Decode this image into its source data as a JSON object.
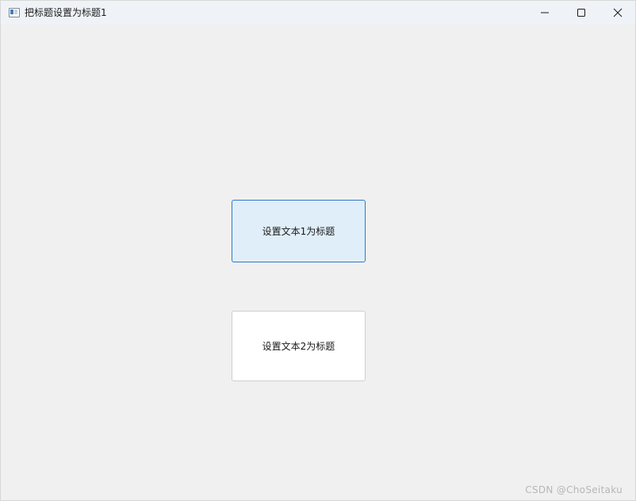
{
  "window": {
    "title": "把标题设置为标题1",
    "controls": {
      "minimize_icon": "minimize-icon",
      "maximize_icon": "maximize-icon",
      "close_icon": "close-icon"
    }
  },
  "buttons": {
    "text1_label": "设置文本1为标题",
    "text2_label": "设置文本2为标题"
  },
  "watermark": "CSDN @ChoSeitaku",
  "colors": {
    "titlebar": "#eff3f7",
    "client_bg": "#f0f0f0",
    "focused_button_bg": "#e0eef9",
    "focused_button_border": "#2d7acb",
    "button_bg": "#ffffff",
    "button_border": "#cfcfcf"
  }
}
